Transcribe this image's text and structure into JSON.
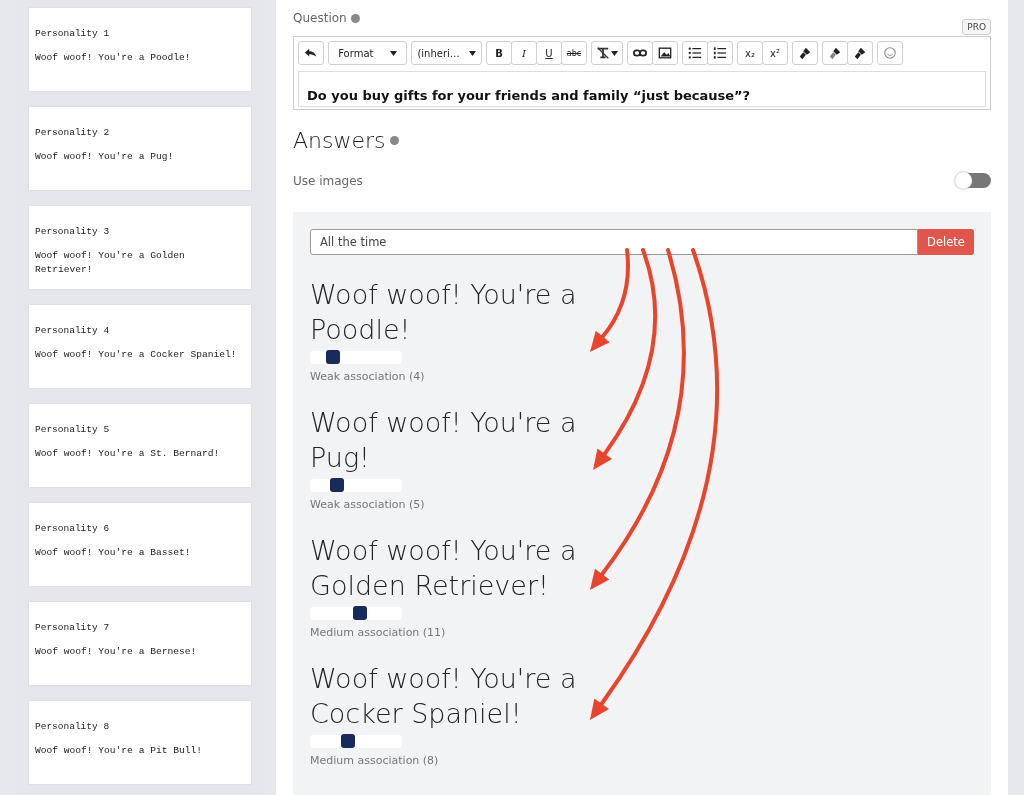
{
  "personalities": [
    {
      "label": "Personality 1",
      "text": "Woof woof! You're a Poodle!"
    },
    {
      "label": "Personality 2",
      "text": "Woof woof! You're a Pug!"
    },
    {
      "label": "Personality 3",
      "text": "Woof woof! You're a Golden Retriever!"
    },
    {
      "label": "Personality 4",
      "text": "Woof woof! You're a Cocker Spaniel!"
    },
    {
      "label": "Personality 5",
      "text": "Woof woof! You're a St. Bernard!"
    },
    {
      "label": "Personality 6",
      "text": "Woof woof! You're a Basset!"
    },
    {
      "label": "Personality 7",
      "text": "Woof woof! You're a Bernese!"
    },
    {
      "label": "Personality 8",
      "text": "Woof woof! You're a Pit Bull!"
    }
  ],
  "question": {
    "label": "Question",
    "badge": "PRO",
    "text": "Do you buy gifts for your friends and family “just because”?",
    "toolbar": [
      [
        {
          "kind": "undo"
        }
      ],
      [
        {
          "kind": "dropdown",
          "label": "Format"
        }
      ],
      [
        {
          "kind": "dropdown",
          "label": "(inheri…"
        }
      ],
      [
        {
          "kind": "bold",
          "label": "B"
        },
        {
          "kind": "italic",
          "label": "I"
        },
        {
          "kind": "underline",
          "label": "U"
        },
        {
          "kind": "strike",
          "label": "abc"
        }
      ],
      [
        {
          "kind": "clear"
        }
      ],
      [
        {
          "kind": "link"
        },
        {
          "kind": "image"
        }
      ],
      [
        {
          "kind": "bullets"
        },
        {
          "kind": "numbers"
        }
      ],
      [
        {
          "kind": "sub",
          "label": "x₂"
        },
        {
          "kind": "sup",
          "label": "x²"
        }
      ],
      [
        {
          "kind": "brush"
        }
      ],
      [
        {
          "kind": "brush2"
        },
        {
          "kind": "brush"
        }
      ],
      [
        {
          "kind": "emoji"
        }
      ]
    ]
  },
  "answers": {
    "title": "Answers",
    "use_images": {
      "label": "Use images",
      "on": false
    },
    "answer": {
      "value": "All the time",
      "delete": "Delete",
      "associations": [
        {
          "title": "Woof woof! You're a Poodle!",
          "level": 0.2,
          "label": "Weak association (4)"
        },
        {
          "title": "Woof woof! You're a Pug!",
          "level": 0.25,
          "label": "Weak association (5)"
        },
        {
          "title": "Woof woof! You're a Golden Retriever!",
          "level": 0.55,
          "label": "Medium association (11)"
        },
        {
          "title": "Woof woof! You're a Cocker Spaniel!",
          "level": 0.4,
          "label": "Medium association (8)"
        }
      ]
    }
  }
}
